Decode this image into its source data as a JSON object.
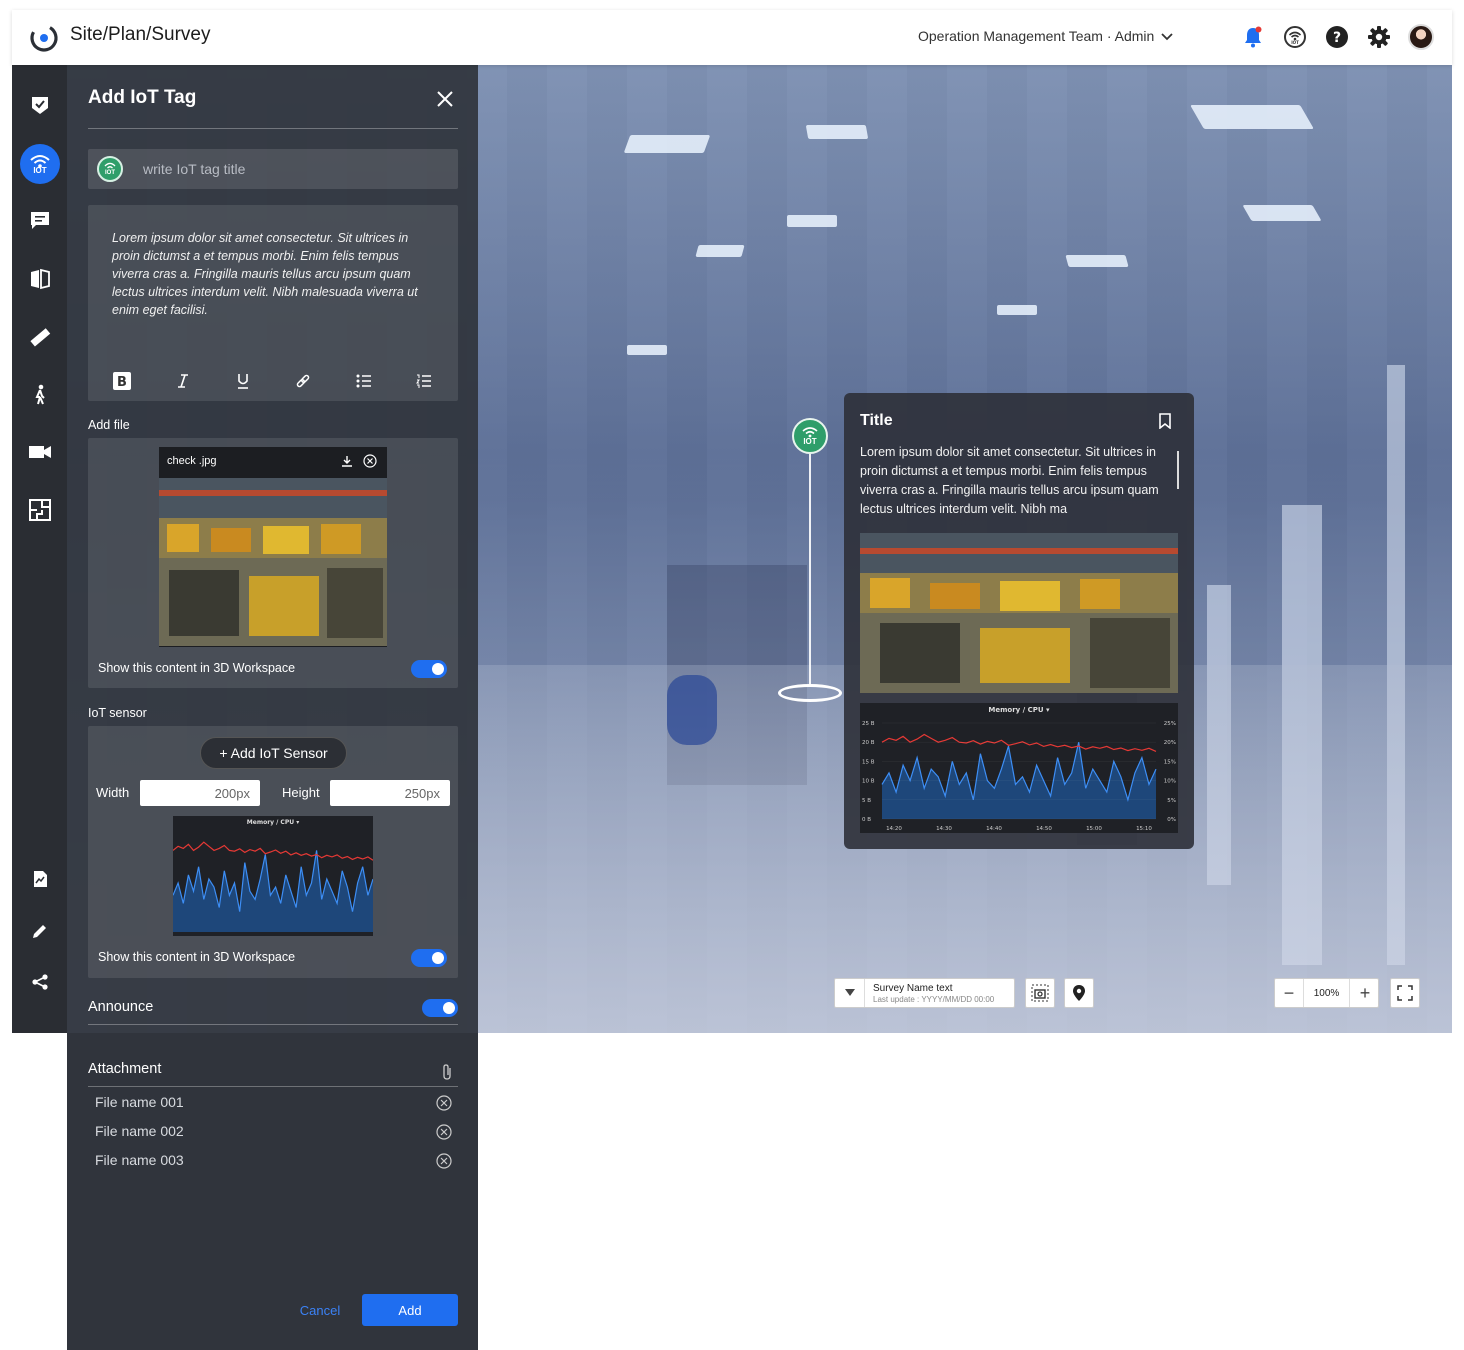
{
  "header": {
    "breadcrumb": "Site/Plan/Survey",
    "team": "Operation Management Team · Admin"
  },
  "panel": {
    "title": "Add IoT Tag",
    "title_placeholder": "write IoT tag title",
    "description": "Lorem ipsum dolor sit amet consectetur. Sit ultrices in proin dictumst a et tempus morbi. Enim felis tempus viverra cras a. Fringilla mauris tellus arcu ipsum quam lectus ultrices interdum velit. Nibh malesuada viverra ut enim eget facilisi.",
    "add_file_label": "Add file",
    "file_name": "check .jpg",
    "show_3d": "Show this content in 3D Workspace",
    "iot_sensor_label": "IoT sensor",
    "add_sensor": "+ Add IoT Sensor",
    "width_label": "Width",
    "width_value": "200px",
    "height_label": "Height",
    "height_value": "250px",
    "announce": "Announce",
    "attachment": "Attachment",
    "attachments": [
      "File name 001",
      "File name 002",
      "File name 003"
    ],
    "cancel": "Cancel",
    "add": "Add",
    "badge_text": "IOT"
  },
  "popup": {
    "title": "Title",
    "text": "Lorem ipsum dolor sit amet consectetur. Sit ultrices in proin dictumst a et tempus morbi. Enim felis tempus viverra cras a. Fringilla mauris tellus arcu ipsum quam lectus ultrices interdum velit. Nibh ma"
  },
  "chart": {
    "title": "Memory / CPU",
    "left_ticks": [
      "25 B",
      "20 B",
      "15 B",
      "10 B",
      "5 B",
      "0 B"
    ],
    "right_ticks": [
      "25%",
      "20%",
      "15%",
      "10%",
      "5%",
      "0%"
    ],
    "x_ticks": [
      "14:20",
      "14:30",
      "14:40",
      "14:50",
      "15:00",
      "15:10"
    ],
    "memory_series": [
      20,
      21,
      20.5,
      21.5,
      20,
      20.8,
      22,
      21,
      20,
      20.5,
      21.2,
      20,
      19.8,
      20.4,
      19.5,
      20.2,
      19.8,
      20.5,
      19.2,
      19.6,
      20.1,
      19.3,
      19.8,
      18.9,
      19.4,
      18.8,
      19.2,
      18.6,
      19.0,
      18.2,
      18.8,
      18.4,
      18.9,
      18.1,
      18.5,
      17.8,
      18.3,
      17.9,
      18.4,
      17.6
    ],
    "cpu_series": [
      9,
      12,
      7,
      14,
      10,
      16,
      8,
      13,
      11,
      6,
      15,
      9,
      12,
      5,
      17,
      10,
      8,
      13,
      19,
      9,
      11,
      7,
      14,
      10,
      6,
      16,
      9,
      12,
      20,
      8,
      13,
      10,
      7,
      15,
      11,
      5,
      12,
      16,
      9,
      13
    ]
  },
  "scene_controls": {
    "survey_name": "Survey Name text",
    "last_update": "Last update : YYYY/MM/DD 00:00",
    "zoom": "100%"
  }
}
